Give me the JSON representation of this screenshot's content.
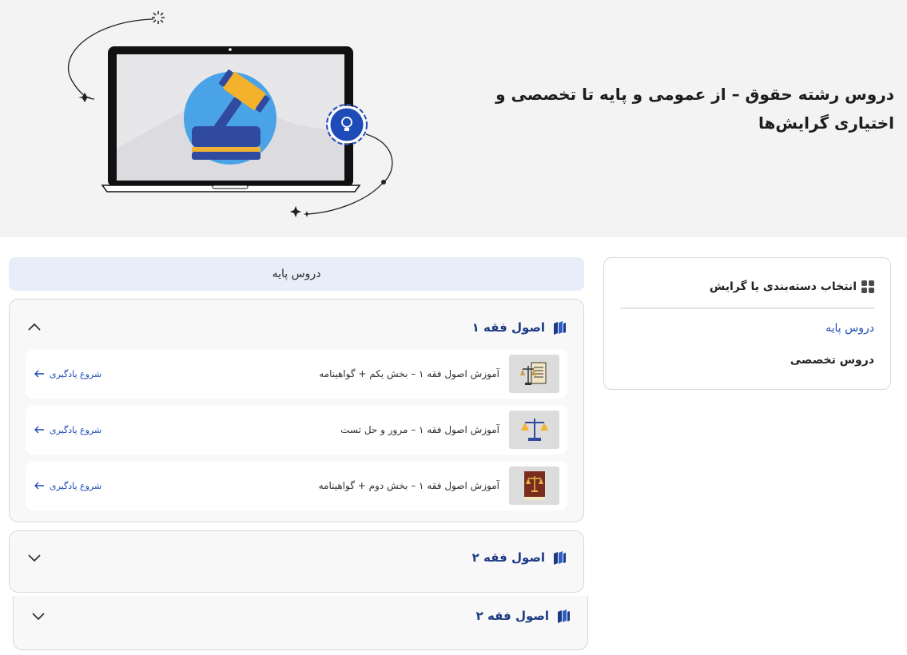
{
  "hero": {
    "title": "دروس رشته حقوق – از عمومی و پایه تا تخصصی و اختیاری گرایش‌ها"
  },
  "sidebar": {
    "title": "انتخاب دسته‌بندی یا گرایش",
    "items": [
      {
        "label": "دروس پایه",
        "active": true
      },
      {
        "label": "دروس تخصصی",
        "active": false
      }
    ]
  },
  "section_tab": {
    "label": "دروس پایه"
  },
  "accordions": [
    {
      "title": "اصول فقه ۱",
      "expanded": true,
      "lessons": [
        {
          "title": "آموزش اصول فقه ۱ – بخش یکم + گواهینامه",
          "action": "شروع یادگیری",
          "thumb_icon": "scales-document-icon"
        },
        {
          "title": "آموزش اصول فقه ۱ – مرور و حل تست",
          "action": "شروع یادگیری",
          "thumb_icon": "scales-icon"
        },
        {
          "title": "آموزش اصول فقه ۱ – بخش دوم + گواهینامه",
          "action": "شروع یادگیری",
          "thumb_icon": "law-book-icon"
        }
      ]
    },
    {
      "title": "اصول فقه ۲",
      "expanded": false
    },
    {
      "title": "اصول فقه ۲",
      "expanded": false
    }
  ],
  "colors": {
    "accent": "#1e4bb8",
    "heading": "#1c3a84",
    "tab_bg": "#e7eef9",
    "hero_bg": "#f3f3f3"
  }
}
